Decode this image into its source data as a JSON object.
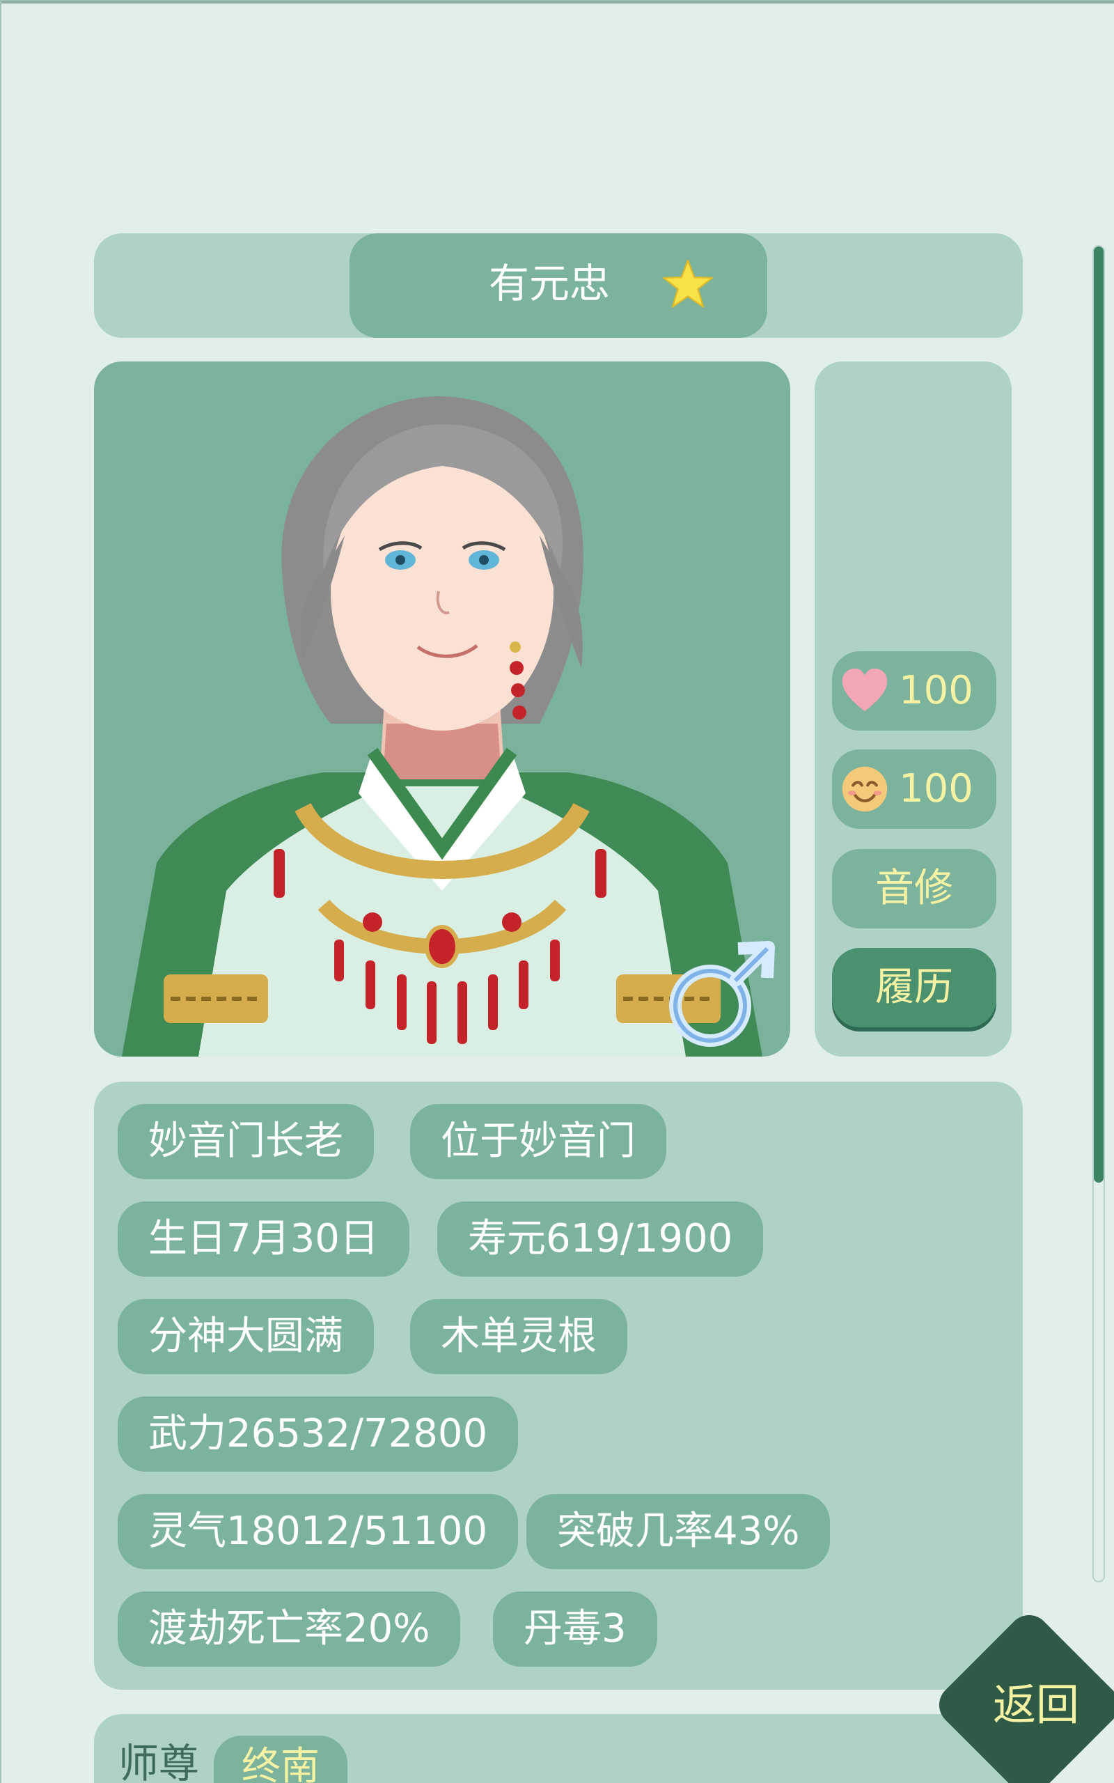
{
  "character": {
    "name": "有元忠",
    "favorite": true,
    "gender": "male"
  },
  "stats": {
    "affection": "100",
    "mood": "100",
    "cultivation_type": "音修",
    "history_button": "履历"
  },
  "tags": {
    "row1": [
      "妙音门长老",
      "位于妙音门"
    ],
    "row2": [
      "生日7月30日",
      "寿元619/1900"
    ],
    "row3": [
      "分神大圆满",
      "木单灵根"
    ],
    "row4": [
      "武力26532/72800"
    ],
    "row5": [
      "灵气18012/51100",
      "突破几率43%"
    ],
    "row6": [
      "渡劫死亡率20%",
      "丹毒3"
    ]
  },
  "relations": {
    "master_label": "师尊",
    "master_value": "终南"
  },
  "actions": {
    "back_label": "返回"
  },
  "colors": {
    "accent_green": "#7bb39d",
    "panel_green": "#afd2c6",
    "background": "#e1efea",
    "highlight_text": "#f6f2a4",
    "dark_button": "#2e5a46"
  },
  "icons": {
    "favorite": "star-icon",
    "gender": "male-icon",
    "affection": "heart-icon",
    "mood": "smile-icon"
  }
}
